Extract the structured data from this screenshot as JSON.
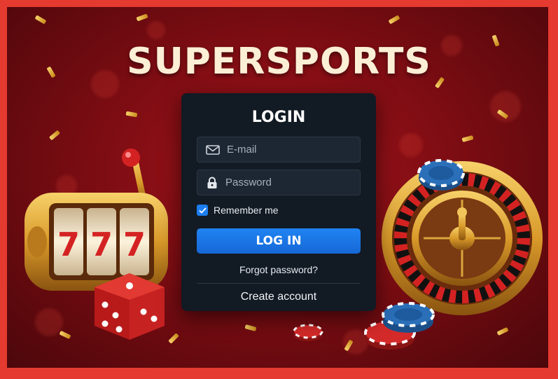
{
  "brand": {
    "title": "SUPERSPORTS"
  },
  "login": {
    "title": "LOGIN",
    "email_placeholder": "E-mail",
    "password_placeholder": "Password",
    "remember_label": "Remember me",
    "remember_checked": true,
    "submit_label": "LOG IN",
    "forgot_label": "Forgot password?",
    "create_label": "Create account"
  },
  "slot": {
    "reels": [
      "7",
      "7",
      "7"
    ]
  },
  "colors": {
    "frame_border": "#e53a2f",
    "panel_bg": "#121a24",
    "accent_blue": "#1c7ef0",
    "brand_text": "#fbefd6"
  },
  "icons": {
    "email": "envelope-icon",
    "password": "padlock-icon",
    "checkbox": "checkmark-icon"
  }
}
